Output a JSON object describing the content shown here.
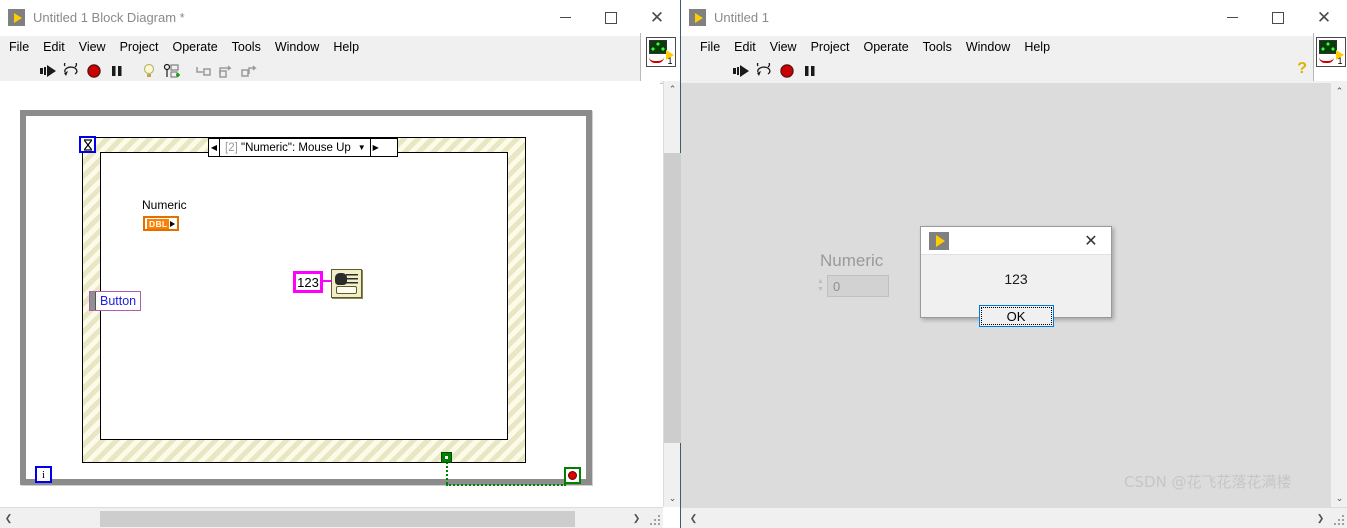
{
  "block_diagram_window": {
    "title": "Untitled 1 Block Diagram *",
    "window_buttons": {
      "minimize": "–",
      "maximize": "□",
      "close": "✕"
    },
    "menu": [
      "File",
      "Edit",
      "View",
      "Project",
      "Operate",
      "Tools",
      "Window",
      "Help"
    ],
    "toolbar": {
      "buttons": [
        {
          "name": "run-button",
          "glyph": "▶"
        },
        {
          "name": "run-continuously-button",
          "glyph": "↻"
        },
        {
          "name": "abort-execution-button",
          "glyph": "●"
        },
        {
          "name": "pause-button",
          "glyph": "❙❙"
        },
        {
          "name": "highlight-execution-button",
          "glyph": "💡"
        },
        {
          "name": "retain-wire-values-button",
          "glyph": "⊕"
        },
        {
          "name": "step-into-button",
          "glyph": "↳"
        },
        {
          "name": "step-over-button",
          "glyph": "⤵"
        },
        {
          "name": "step-out-button",
          "glyph": "⤴"
        }
      ],
      "help_glyph": "?"
    },
    "vi_icon_number": "1",
    "diagram": {
      "event_structure": {
        "case_label_prefix": "[2]",
        "case_label": "\"Numeric\": Mouse Up",
        "left_arrow": "◀",
        "right_arrow": "▶",
        "caret": "▼",
        "timeout_terminal_glyph": "⧗"
      },
      "numeric_terminal": {
        "label": "Numeric",
        "type": "DBL"
      },
      "button_terminal": {
        "label": "Button"
      },
      "string_constant": {
        "value": "123"
      },
      "dialog_vi": {
        "name": "one-button-dialog-vi"
      },
      "iteration_terminal": {
        "glyph": "i"
      },
      "stop_terminal": {
        "name": "loop-condition-terminal"
      }
    }
  },
  "front_panel_window": {
    "title": "Untitled 1",
    "window_buttons": {
      "minimize": "–",
      "maximize": "□",
      "close": "✕"
    },
    "menu": [
      "File",
      "Edit",
      "View",
      "Project",
      "Operate",
      "Tools",
      "Window",
      "Help"
    ],
    "toolbar": {
      "buttons": [
        {
          "name": "run-button",
          "glyph": "▶"
        },
        {
          "name": "run-continuously-button",
          "glyph": "↻"
        },
        {
          "name": "abort-execution-button",
          "glyph": "●"
        },
        {
          "name": "pause-button",
          "glyph": "❙❙"
        }
      ],
      "help_glyph": "?"
    },
    "vi_icon_number": "1",
    "numeric_control": {
      "label": "Numeric",
      "value": "0",
      "up_glyph": "▲",
      "down_glyph": "▼"
    }
  },
  "dialog": {
    "message": "123",
    "ok_label": "OK",
    "close_glyph": "✕"
  },
  "watermark": {
    "text": "CSDN @花飞花落花满楼"
  },
  "scrollbars": {
    "up_glyph": "⌃",
    "down_glyph": "⌄",
    "left_glyph": "❮",
    "right_glyph": "❯"
  }
}
